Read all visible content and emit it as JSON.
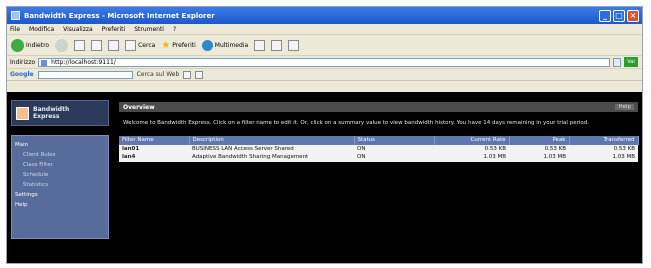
{
  "window": {
    "title": "Bandwidth Express - Microsoft Internet Explorer"
  },
  "menu": [
    "File",
    "Modifica",
    "Visualizza",
    "Preferiti",
    "Strumenti",
    "?"
  ],
  "toolbar": {
    "back_label": "Indietro",
    "search_label": "Cerca",
    "favorites_label": "Preferiti",
    "multimedia_label": "Multimedia"
  },
  "address": {
    "label": "Indirizzo",
    "value": "http://localhost:9111/",
    "go_label": "Vai"
  },
  "googlebar": {
    "logo": "Google",
    "search_web_label": "Cerca sul Web"
  },
  "sidebar": {
    "logo_line1": "Bandwidth",
    "logo_line2": "Express",
    "items": [
      {
        "label": "Main",
        "sub": false
      },
      {
        "label": "Client Rules",
        "sub": true
      },
      {
        "label": "Class Filter",
        "sub": true
      },
      {
        "label": "Schedule",
        "sub": true
      },
      {
        "label": "Statistics",
        "sub": true
      },
      {
        "label": "Settings",
        "sub": false
      },
      {
        "label": "Help",
        "sub": false
      }
    ]
  },
  "main": {
    "header_title": "Overview",
    "help_label": "Help",
    "intro": "Welcome to Bandwidth Express. Click on a filter name to edit it. Or, click on a summary value to view bandwidth history. You have 14 days remaining in your trial period.",
    "columns": [
      "Filter Name",
      "Description",
      "Status",
      "Current Rate",
      "Peak",
      "Transferred"
    ],
    "rows": [
      {
        "name": "lan01",
        "description": "BUSINESS LAN Access Server Shared",
        "status": "ON",
        "rate": "0.53 KB",
        "peak": "0.53 KB",
        "transferred": "0.53 KB"
      },
      {
        "name": "lan4",
        "description": "Adaptive Bandwidth Sharing Management",
        "status": "ON",
        "rate": "1.03 MB",
        "peak": "1.03 MB",
        "transferred": "1.03 MB"
      }
    ]
  }
}
